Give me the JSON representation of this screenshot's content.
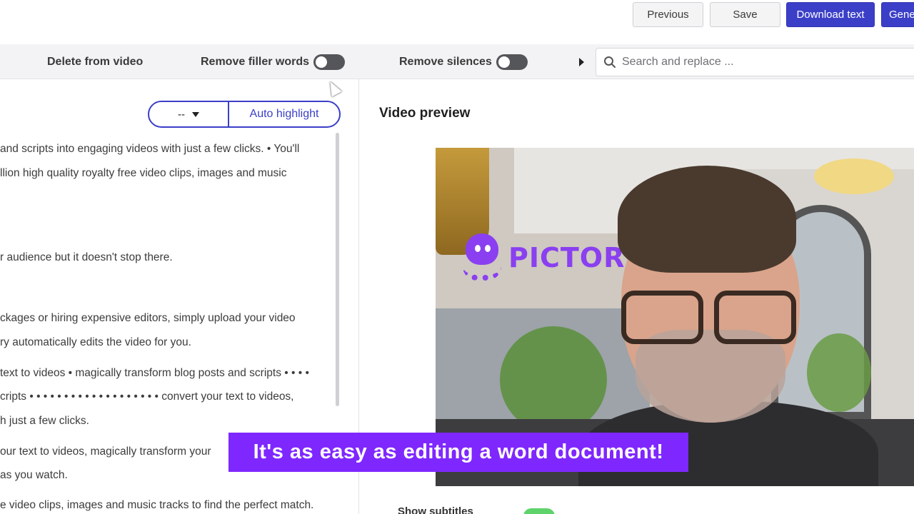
{
  "topbar": {
    "previous_label": "Previous",
    "save_label": "Save",
    "download_label": "Download text",
    "generate_label": "Gene"
  },
  "toolbar": {
    "delete_label": "Delete from video",
    "filler_label": "Remove filler words",
    "silences_label": "Remove silences",
    "filler_on": false,
    "silences_on": false,
    "search_placeholder": "Search and replace ..."
  },
  "transcript": {
    "highlight_select": "--",
    "auto_highlight_label": "Auto highlight",
    "lines": [
      "and scripts into engaging videos with just a few clicks. • You'll",
      "llion high quality royalty free video clips, images and music",
      "r audience but it doesn't stop there.",
      "ckages or hiring expensive editors, simply upload your video",
      "ry automatically edits the video for you.",
      "text to videos • magically transform blog posts and scripts • • • •",
      "cripts • • • • • • • • • • • • • • • • • • • convert your text to videos,",
      "h just a few clicks.",
      "our text to videos, magically transform your",
      "as you watch.",
      "e video clips, images and music tracks to find the perfect match."
    ]
  },
  "preview": {
    "title": "Video preview",
    "logo_text": "PICTOR",
    "caption": "It's as easy as editing a word document!",
    "show_subtitles_label": "Show subtitles",
    "show_subtitles_on": true
  },
  "colors": {
    "primary": "#3b3fc7",
    "caption_bg": "#7f27ff",
    "brand_purple": "#8a3ff0",
    "toggle_off": "#55565a",
    "toggle_on": "#5ed36b"
  }
}
